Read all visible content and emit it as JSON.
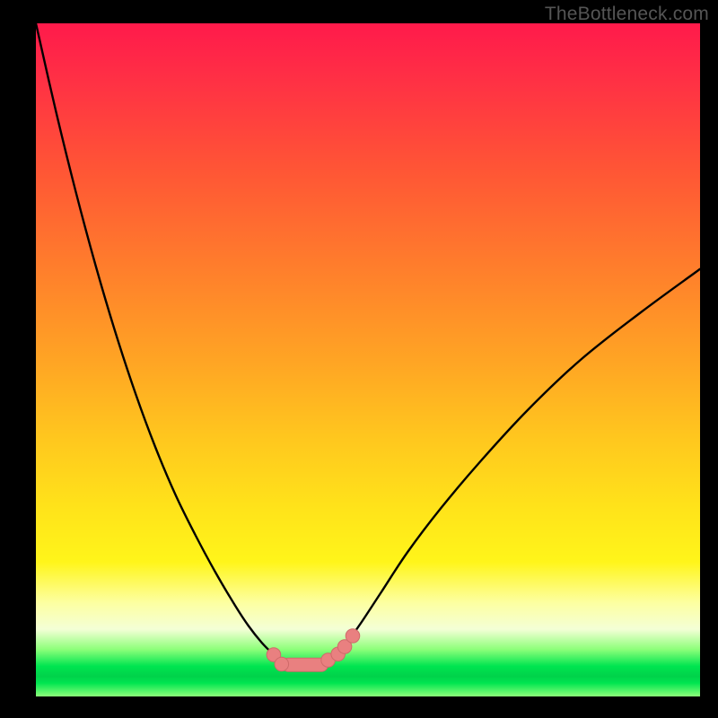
{
  "watermark": "TheBottleneck.com",
  "colors": {
    "frame": "#000000",
    "curve": "#000000",
    "marker_fill": "#e98080",
    "marker_stroke": "#cf6a6a"
  },
  "chart_data": {
    "type": "line",
    "title": "",
    "xlabel": "",
    "ylabel": "",
    "xlim": [
      0,
      100
    ],
    "ylim": [
      0,
      100
    ],
    "grid": false,
    "legend": false,
    "series": [
      {
        "name": "curve-left",
        "x": [
          0,
          3,
          6,
          9,
          12,
          15,
          18,
          21,
          24,
          27,
          30,
          32,
          34,
          35.8
        ],
        "y": [
          100,
          87,
          75,
          64,
          54,
          45,
          37,
          30,
          24,
          18.5,
          13.5,
          10.5,
          8,
          6.2
        ]
      },
      {
        "name": "curve-right",
        "x": [
          45.5,
          47,
          49,
          52,
          56,
          61,
          67,
          74,
          82,
          91,
          100
        ],
        "y": [
          6.3,
          8.2,
          11,
          15.5,
          21.5,
          28,
          35,
          42.5,
          50,
          57,
          63.5
        ]
      },
      {
        "name": "floor-segment",
        "x": [
          37,
          38.5,
          40,
          41.5,
          43,
          44
        ],
        "y": [
          4.8,
          4.6,
          4.6,
          4.7,
          5.0,
          5.4
        ]
      }
    ],
    "markers": [
      {
        "x": 35.8,
        "y": 6.2,
        "r": 1.05
      },
      {
        "x": 37.0,
        "y": 4.8,
        "r": 1.05
      },
      {
        "x": 44.0,
        "y": 5.4,
        "r": 1.05
      },
      {
        "x": 45.5,
        "y": 6.3,
        "r": 1.05
      },
      {
        "x": 46.5,
        "y": 7.4,
        "r": 1.05
      },
      {
        "x": 47.7,
        "y": 9.0,
        "r": 1.05
      }
    ],
    "floor_bar": {
      "x0": 37.0,
      "x1": 44.0,
      "y": 4.7,
      "thickness": 2.0
    }
  }
}
